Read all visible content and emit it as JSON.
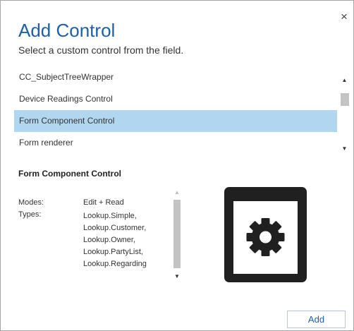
{
  "dialog": {
    "title": "Add Control",
    "subtitle": "Select a custom control from the field.",
    "close_icon": "×"
  },
  "controls_list": {
    "items": [
      {
        "label": "CC_SubjectTreeWrapper",
        "selected": false
      },
      {
        "label": "Device Readings Control",
        "selected": false
      },
      {
        "label": "Form Component Control",
        "selected": true
      },
      {
        "label": "Form renderer",
        "selected": false
      }
    ],
    "scroll_up_icon": "▲",
    "scroll_down_icon": "▼"
  },
  "details": {
    "title": "Form Component Control",
    "modes_label": "Modes:",
    "modes_value": "Edit + Read",
    "types_label": "Types:",
    "types": [
      "Lookup.Simple,",
      "Lookup.Customer,",
      "Lookup.Owner,",
      "Lookup.PartyList,",
      "Lookup.Regarding"
    ],
    "scroll_up_icon": "▲",
    "scroll_down_icon": "▼",
    "preview_icon": "gear-window-icon"
  },
  "footer": {
    "add_label": "Add"
  },
  "colors": {
    "title": "#1f5fa8",
    "selected_row": "#b1d6f0",
    "preview_icon": "#202020"
  }
}
